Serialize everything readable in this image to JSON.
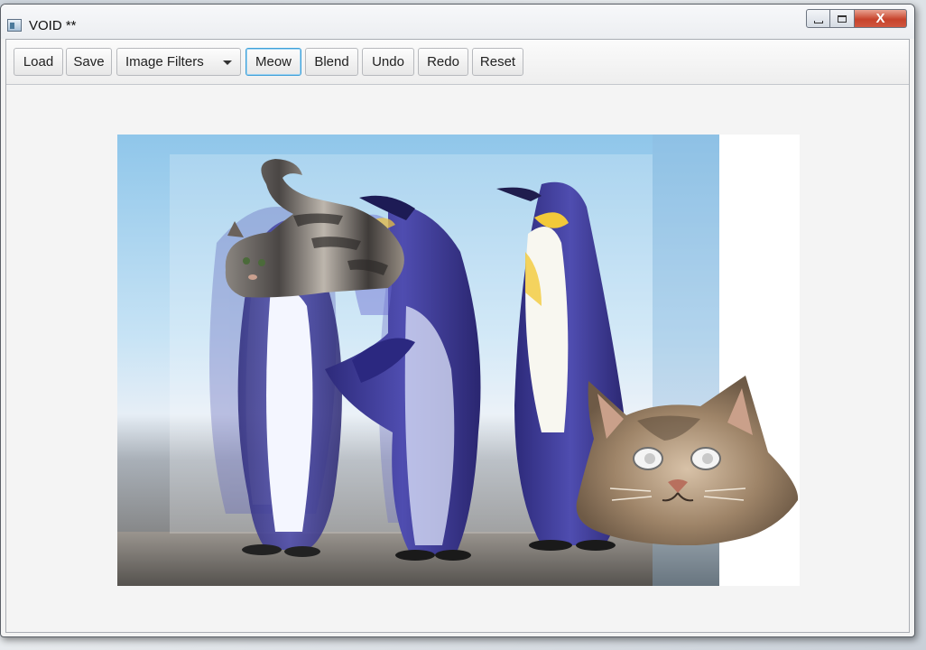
{
  "window": {
    "title": "VOID **",
    "close_label": "X"
  },
  "toolbar": {
    "load_label": "Load",
    "save_label": "Save",
    "filters_label": "Image Filters",
    "meow_label": "Meow",
    "blend_label": "Blend",
    "undo_label": "Undo",
    "redo_label": "Redo",
    "reset_label": "Reset"
  },
  "icons": {
    "app": "window-app-icon",
    "minimize": "minimize-icon",
    "maximize": "maximize-icon",
    "close": "close-icon",
    "dropdown": "chevron-down-icon"
  },
  "colors": {
    "focus_border": "#3fa0d8",
    "close_button": "#c7432c",
    "sky": "#a9d4ef",
    "penguin_blue": "#3d3a9a",
    "penguin_yellow": "#f3c93a",
    "sand": "#8a8580",
    "cat_tabby": "#8a7a68"
  }
}
